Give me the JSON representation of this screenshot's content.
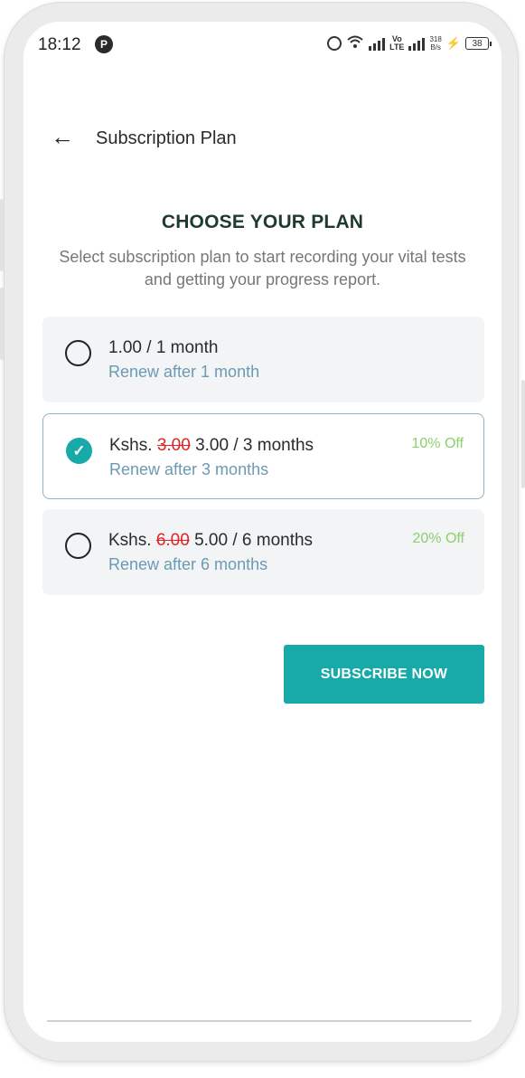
{
  "status_bar": {
    "time": "18:12",
    "app_badge": "P",
    "network_label_top": "Vo",
    "network_label_bottom": "LTE",
    "speed_top": "318",
    "speed_bottom": "B/s",
    "battery": "38"
  },
  "header": {
    "back_icon": "←",
    "title": "Subscription Plan"
  },
  "content": {
    "heading": "CHOOSE YOUR PLAN",
    "subtitle": "Select subscription plan to start recording your vital tests and getting your progress report."
  },
  "plans": [
    {
      "selected": false,
      "prefix": "",
      "old_price": "",
      "price": "1.00 / 1 month",
      "renew": "Renew after 1 month",
      "discount": ""
    },
    {
      "selected": true,
      "prefix": "Kshs. ",
      "old_price": "3.00",
      "price": " 3.00 / 3 months",
      "renew": "Renew after 3 months",
      "discount": "10% Off"
    },
    {
      "selected": false,
      "prefix": "Kshs. ",
      "old_price": "6.00",
      "price": " 5.00 / 6 months",
      "renew": "Renew after 6 months",
      "discount": "20% Off"
    }
  ],
  "actions": {
    "subscribe_label": "SUBSCRIBE NOW"
  },
  "colors": {
    "accent": "#17aaa8",
    "discount": "#8bd06a",
    "renew_text": "#6b9ab3",
    "strike_price": "#e02424"
  }
}
